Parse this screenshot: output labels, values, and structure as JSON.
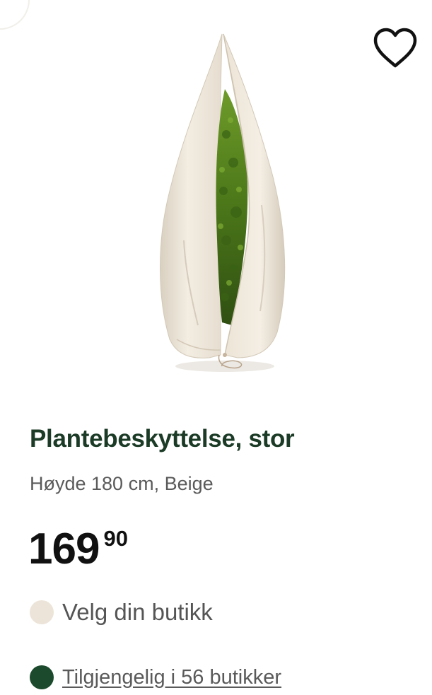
{
  "product": {
    "name": "Plantebeskyttelse, stor",
    "description": "Høyde 180 cm, Beige",
    "price_integer": "169",
    "price_decimal": "90",
    "image_alt": "Plant protection cover, beige, with zipper"
  },
  "store": {
    "label": "Velg din butikk",
    "indicator_color": "#ece4d8"
  },
  "availability": {
    "label": "Tilgjengelig i 56 butikker",
    "indicator_color": "#1b4a2c"
  },
  "icons": {
    "favorite": "heart-icon",
    "store_status": "store-status-dot-icon",
    "availability_status": "availability-dot-icon"
  },
  "colors": {
    "title": "#1b3b26",
    "text_secondary": "#5a5a5a",
    "price": "#111111",
    "cover_beige": "#efe8dc",
    "foliage": "#4f7a1e"
  }
}
